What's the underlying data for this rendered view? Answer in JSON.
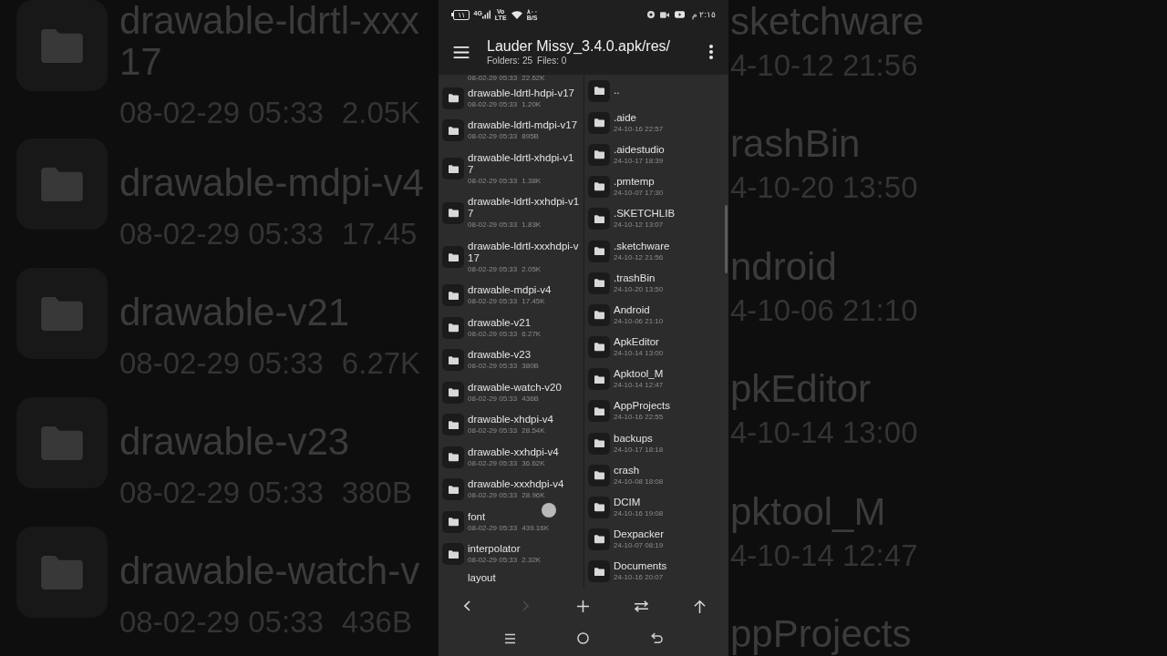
{
  "status_bar": {
    "battery": "١١",
    "network": "4G",
    "volte": [
      "Vo",
      "LTE"
    ],
    "speed": [
      "٨٠٠",
      "B/S"
    ],
    "time": "٢:١٥ م"
  },
  "app_bar": {
    "title": "Lauder Missy_3.4.0.apk/res/",
    "folders": "Folders: 25",
    "files": "Files: 0"
  },
  "left_pane": {
    "rows": [
      {
        "date": "08-02-29 05:33",
        "size": "22.62K"
      },
      {
        "name": "drawable-ldrtl-hdpi-v17",
        "date": "08-02-29 05:33",
        "size": "1.20K"
      },
      {
        "name": "drawable-ldrtl-mdpi-v17",
        "date": "08-02-29 05:33",
        "size": "895B"
      },
      {
        "name": "drawable-ldrtl-xhdpi-v17",
        "date": "08-02-29 05:33",
        "size": "1.38K"
      },
      {
        "name": "drawable-ldrtl-xxhdpi-v17",
        "date": "08-02-29 05:33",
        "size": "1.83K"
      },
      {
        "name": "drawable-ldrtl-xxxhdpi-v17",
        "date": "08-02-29 05:33",
        "size": "2.05K"
      },
      {
        "name": "drawable-mdpi-v4",
        "date": "08-02-29 05:33",
        "size": "17.45K"
      },
      {
        "name": "drawable-v21",
        "date": "08-02-29 05:33",
        "size": "6.27K"
      },
      {
        "name": "drawable-v23",
        "date": "08-02-29 05:33",
        "size": "380B"
      },
      {
        "name": "drawable-watch-v20",
        "date": "08-02-29 05:33",
        "size": "436B"
      },
      {
        "name": "drawable-xhdpi-v4",
        "date": "08-02-29 05:33",
        "size": "28.54K"
      },
      {
        "name": "drawable-xxhdpi-v4",
        "date": "08-02-29 05:33",
        "size": "36.62K"
      },
      {
        "name": "drawable-xxxhdpi-v4",
        "date": "08-02-29 05:33",
        "size": "28.96K"
      },
      {
        "name": "font",
        "date": "08-02-29 05:33",
        "size": "439.16K"
      },
      {
        "name": "interpolator",
        "date": "08-02-29 05:33",
        "size": "2.32K"
      },
      {
        "name": "layout"
      }
    ]
  },
  "right_pane": {
    "rows": [
      {
        "name": ".."
      },
      {
        "name": ".aide",
        "date": "24-10-16 22:57"
      },
      {
        "name": ".aidestudio",
        "date": "24-10-17 18:39"
      },
      {
        "name": ".pmtemp",
        "date": "24-10-07 17:30"
      },
      {
        "name": ".SKETCHLIB",
        "date": "24-10-12 13:07"
      },
      {
        "name": ".sketchware",
        "date": "24-10-12 21:56"
      },
      {
        "name": ".trashBin",
        "date": "24-10-20 13:50"
      },
      {
        "name": "Android",
        "date": "24-10-06 21:10"
      },
      {
        "name": "ApkEditor",
        "date": "24-10-14 13:00"
      },
      {
        "name": "Apktool_M",
        "date": "24-10-14 12:47"
      },
      {
        "name": "AppProjects",
        "date": "24-10-16 22:55"
      },
      {
        "name": "backups",
        "date": "24-10-17 18:18"
      },
      {
        "name": "crash",
        "date": "24-10-08 18:08"
      },
      {
        "name": "DCIM",
        "date": "24-10-16 19:08"
      },
      {
        "name": "Dexpacker",
        "date": "24-10-07 08:19"
      },
      {
        "name": "Documents",
        "date": "24-10-16 20:07"
      }
    ]
  },
  "toolbar": [
    {
      "kind": "back",
      "disabled": false
    },
    {
      "kind": "forward",
      "disabled": true
    },
    {
      "kind": "new",
      "disabled": false
    },
    {
      "kind": "swap",
      "disabled": false
    },
    {
      "kind": "up",
      "disabled": false
    }
  ],
  "backdrop_left": [
    {
      "name_lines": [
        "drawable-ldrtl-xxx",
        "17"
      ],
      "date": "08-02-29 05:33",
      "size": "2.05K"
    },
    {
      "name_lines": [
        "drawable-mdpi-v4"
      ],
      "date": "08-02-29 05:33",
      "size": "17.45"
    },
    {
      "name_lines": [
        "drawable-v21"
      ],
      "date": "08-02-29 05:33",
      "size": "6.27K"
    },
    {
      "name_lines": [
        "drawable-v23"
      ],
      "date": "08-02-29 05:33",
      "size": "380B"
    },
    {
      "name_lines": [
        "drawable-watch-v"
      ],
      "date": "08-02-29 05:33",
      "size": "436B"
    }
  ],
  "backdrop_right": [
    {
      "name": "sketchware",
      "date": "4-10-12 21:56"
    },
    {
      "name": "rashBin",
      "date": "4-10-20 13:50"
    },
    {
      "name": "ndroid",
      "date": "4-10-06 21:10"
    },
    {
      "name": "pkEditor",
      "date": "4-10-14 13:00"
    },
    {
      "name": "pktool_M",
      "date": "4-10-14 12:47"
    },
    {
      "name": "ppProjects"
    }
  ]
}
